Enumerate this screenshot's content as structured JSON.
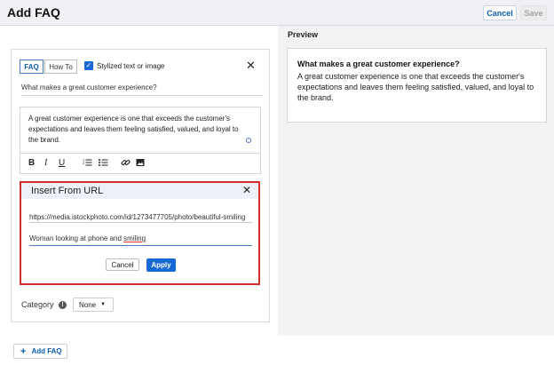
{
  "header": {
    "title": "Add FAQ",
    "cancel_label": "Cancel",
    "save_label": "Save"
  },
  "preview": {
    "label": "Preview",
    "question": "What makes a great customer experience?",
    "answer": "A great customer experience is one that exceeds the customer's expectations and leaves them feeling satisfied, valued, and loyal to the brand."
  },
  "editor": {
    "tabs": [
      "FAQ",
      "How To"
    ],
    "checkbox_label": "Stylized text or image",
    "question": "What makes a great customer experience?",
    "answer": "A great customer experience is one that exceeds the customer's expectations and leaves them feeling satisfied, valued, and loyal to the brand.",
    "toolbar": {
      "bold": "B",
      "italic": "I",
      "underline": "U"
    },
    "category_label": "Category",
    "category_value": "None"
  },
  "dialog": {
    "title": "Insert From URL",
    "url_value": "https://media.istockphoto.com/id/1273477705/photo/beautiful-smiling",
    "alt_text_prefix": "Woman looking at phone and ",
    "alt_text_underlined": "smiling",
    "cancel_label": "Cancel",
    "apply_label": "Apply"
  },
  "footer": {
    "add_faq_label": "Add FAQ"
  },
  "colors": {
    "accent": "#1769d6",
    "highlight_border": "#d22c2c"
  }
}
